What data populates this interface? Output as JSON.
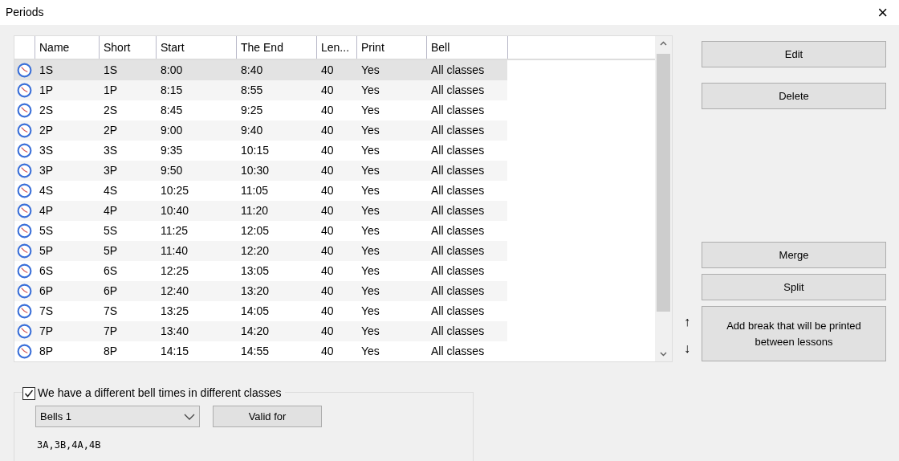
{
  "window": {
    "title": "Periods",
    "close": "×"
  },
  "table": {
    "columns": [
      "Name",
      "Short",
      "Start",
      "The End",
      "Len...",
      "Print",
      "Bell"
    ],
    "rows": [
      {
        "cells": [
          "1S",
          "1S",
          "8:00",
          "8:40",
          "40",
          "Yes",
          "All classes"
        ],
        "selected": true
      },
      {
        "cells": [
          "1P",
          "1P",
          "8:15",
          "8:55",
          "40",
          "Yes",
          "All classes"
        ],
        "selected": false
      },
      {
        "cells": [
          "2S",
          "2S",
          "8:45",
          "9:25",
          "40",
          "Yes",
          "All classes"
        ],
        "selected": false
      },
      {
        "cells": [
          "2P",
          "2P",
          "9:00",
          "9:40",
          "40",
          "Yes",
          "All classes"
        ],
        "selected": false
      },
      {
        "cells": [
          "3S",
          "3S",
          "9:35",
          "10:15",
          "40",
          "Yes",
          "All classes"
        ],
        "selected": false
      },
      {
        "cells": [
          "3P",
          "3P",
          "9:50",
          "10:30",
          "40",
          "Yes",
          "All classes"
        ],
        "selected": false
      },
      {
        "cells": [
          "4S",
          "4S",
          "10:25",
          "11:05",
          "40",
          "Yes",
          "All classes"
        ],
        "selected": false
      },
      {
        "cells": [
          "4P",
          "4P",
          "10:40",
          "11:20",
          "40",
          "Yes",
          "All classes"
        ],
        "selected": false
      },
      {
        "cells": [
          "5S",
          "5S",
          "11:25",
          "12:05",
          "40",
          "Yes",
          "All classes"
        ],
        "selected": false
      },
      {
        "cells": [
          "5P",
          "5P",
          "11:40",
          "12:20",
          "40",
          "Yes",
          "All classes"
        ],
        "selected": false
      },
      {
        "cells": [
          "6S",
          "6S",
          "12:25",
          "13:05",
          "40",
          "Yes",
          "All classes"
        ],
        "selected": false
      },
      {
        "cells": [
          "6P",
          "6P",
          "12:40",
          "13:20",
          "40",
          "Yes",
          "All classes"
        ],
        "selected": false
      },
      {
        "cells": [
          "7S",
          "7S",
          "13:25",
          "14:05",
          "40",
          "Yes",
          "All classes"
        ],
        "selected": false
      },
      {
        "cells": [
          "7P",
          "7P",
          "13:40",
          "14:20",
          "40",
          "Yes",
          "All classes"
        ],
        "selected": false
      },
      {
        "cells": [
          "8P",
          "8P",
          "14:15",
          "14:55",
          "40",
          "Yes",
          "All classes"
        ],
        "selected": false
      }
    ]
  },
  "buttons_top": [
    "Edit",
    "Delete"
  ],
  "buttons_bottom": [
    "Merge",
    "Split"
  ],
  "move_arrows": [
    "↑",
    "↓"
  ],
  "break_button": "Add break that will be printed between lessons",
  "bells": {
    "checkbox_label": "We have a different bell times in different classes",
    "checked": true,
    "select_value": "Bells 1",
    "valid_for_button": "Valid for",
    "classes": "3A,3B,4A,4B"
  }
}
